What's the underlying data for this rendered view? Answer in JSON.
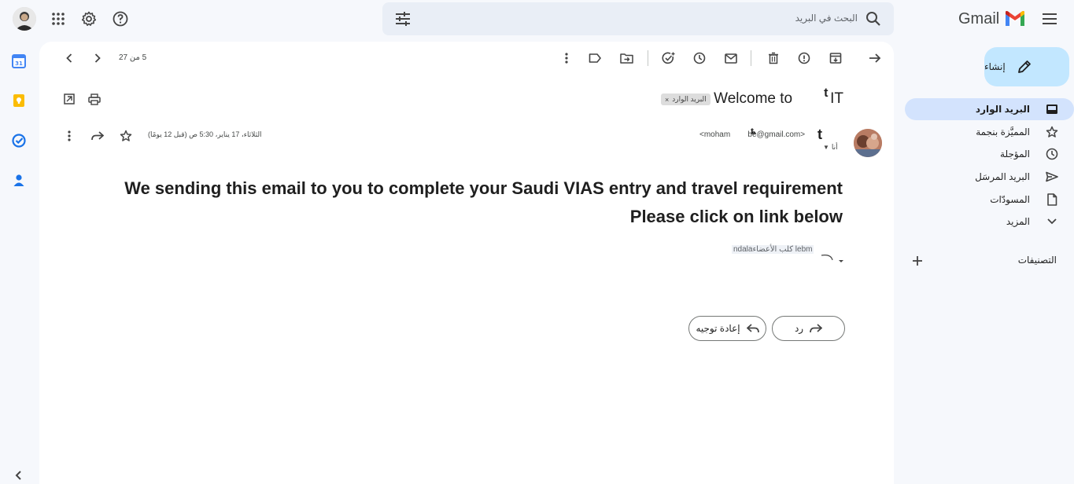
{
  "app": {
    "brand": "Gmail"
  },
  "search": {
    "placeholder": "البحث في البريد"
  },
  "compose": {
    "label": "إنشاء"
  },
  "nav": {
    "items": [
      {
        "label": "البريد الوارد",
        "icon": "inbox-icon",
        "active": true
      },
      {
        "label": "المميَّزة بنجمة",
        "icon": "star-icon"
      },
      {
        "label": "المؤجلة",
        "icon": "clock-icon"
      },
      {
        "label": "البريد المرسَل",
        "icon": "send-icon"
      },
      {
        "label": "المسودّات",
        "icon": "file-icon"
      },
      {
        "label": "المزيد",
        "icon": "chevron-down-icon"
      }
    ],
    "labels_heading": "التصنيفات"
  },
  "toolbar": {
    "pagination": "5 من 27"
  },
  "email": {
    "subject_prefix": "Welcome to",
    "subject_suffix": "IT",
    "subject_mark": "t",
    "label_chip": "البريد الوارد",
    "sender_email": "<moham        be@gmail.com>",
    "sender_mark": "t",
    "to_me": "أنا",
    "date": "الثلاثاء، 17 يناير، 5:30 ص (قبل 12 يومًا)",
    "body_line1": "We sending this email to you to complete your Saudi VIAS entry and travel requirement",
    "body_line2": "Please click on link below",
    "quoted_sender": "ndalaكلب الأعضاء lebm",
    "reply_label": "رد",
    "forward_label": "إعادة توجيه"
  },
  "colors": {
    "accent": "#d3e3fd",
    "compose": "#c2e7ff",
    "background": "#f6f8fc"
  }
}
